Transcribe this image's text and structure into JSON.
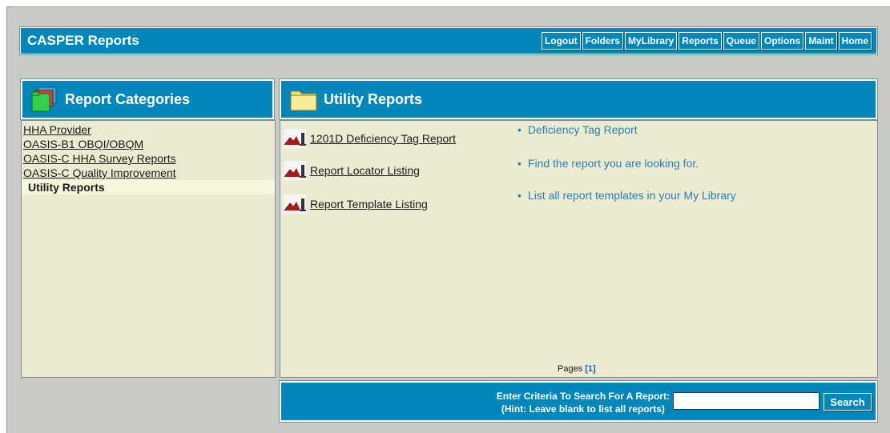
{
  "header": {
    "title": "CASPER Reports",
    "nav": [
      "Logout",
      "Folders",
      "MyLibrary",
      "Reports",
      "Queue",
      "Options",
      "Maint",
      "Home"
    ]
  },
  "left_panel": {
    "title": "Report Categories",
    "categories": [
      {
        "label": "HHA Provider",
        "active": false
      },
      {
        "label": "OASIS-B1 OBQI/OBQM",
        "active": false
      },
      {
        "label": "OASIS-C HHA Survey Reports",
        "active": false
      },
      {
        "label": "OASIS-C Quality Improvement",
        "active": false
      },
      {
        "label": "Utility Reports",
        "active": true
      }
    ]
  },
  "right_panel": {
    "title": "Utility Reports",
    "reports": [
      {
        "label": "1201D Deficiency Tag Report",
        "description": "Deficiency Tag Report"
      },
      {
        "label": "Report Locator Listing",
        "description": "Find the report you are looking for."
      },
      {
        "label": "Report Template Listing",
        "description": "List all report templates in your My Library"
      }
    ],
    "pager": {
      "label": "Pages",
      "current": "[1]"
    }
  },
  "search": {
    "line1": "Enter Criteria To Search For A Report:",
    "line2": "(Hint: Leave blank to list all reports)",
    "value": "",
    "button": "Search"
  },
  "colors": {
    "bar": "#0287bb",
    "panel": "#ecebd1",
    "frame": "#c9cbc6",
    "desc": "#2a7fb1"
  }
}
